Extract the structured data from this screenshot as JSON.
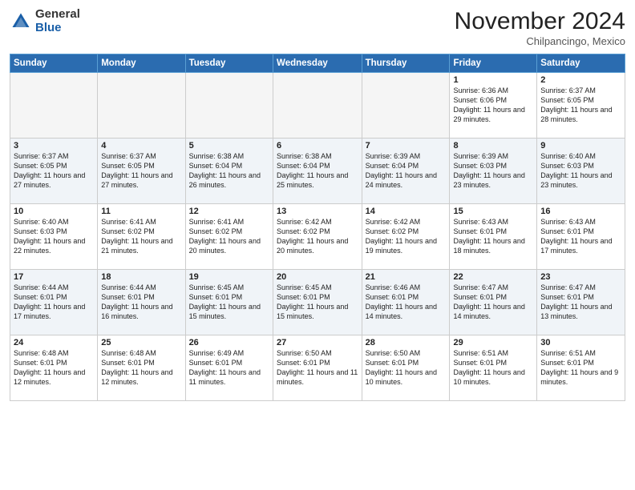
{
  "logo": {
    "general": "General",
    "blue": "Blue"
  },
  "title": "November 2024",
  "location": "Chilpancingo, Mexico",
  "days_of_week": [
    "Sunday",
    "Monday",
    "Tuesday",
    "Wednesday",
    "Thursday",
    "Friday",
    "Saturday"
  ],
  "weeks": [
    [
      {
        "day": "",
        "info": ""
      },
      {
        "day": "",
        "info": ""
      },
      {
        "day": "",
        "info": ""
      },
      {
        "day": "",
        "info": ""
      },
      {
        "day": "",
        "info": ""
      },
      {
        "day": "1",
        "info": "Sunrise: 6:36 AM\nSunset: 6:06 PM\nDaylight: 11 hours and 29 minutes."
      },
      {
        "day": "2",
        "info": "Sunrise: 6:37 AM\nSunset: 6:05 PM\nDaylight: 11 hours and 28 minutes."
      }
    ],
    [
      {
        "day": "3",
        "info": "Sunrise: 6:37 AM\nSunset: 6:05 PM\nDaylight: 11 hours and 27 minutes."
      },
      {
        "day": "4",
        "info": "Sunrise: 6:37 AM\nSunset: 6:05 PM\nDaylight: 11 hours and 27 minutes."
      },
      {
        "day": "5",
        "info": "Sunrise: 6:38 AM\nSunset: 6:04 PM\nDaylight: 11 hours and 26 minutes."
      },
      {
        "day": "6",
        "info": "Sunrise: 6:38 AM\nSunset: 6:04 PM\nDaylight: 11 hours and 25 minutes."
      },
      {
        "day": "7",
        "info": "Sunrise: 6:39 AM\nSunset: 6:04 PM\nDaylight: 11 hours and 24 minutes."
      },
      {
        "day": "8",
        "info": "Sunrise: 6:39 AM\nSunset: 6:03 PM\nDaylight: 11 hours and 23 minutes."
      },
      {
        "day": "9",
        "info": "Sunrise: 6:40 AM\nSunset: 6:03 PM\nDaylight: 11 hours and 23 minutes."
      }
    ],
    [
      {
        "day": "10",
        "info": "Sunrise: 6:40 AM\nSunset: 6:03 PM\nDaylight: 11 hours and 22 minutes."
      },
      {
        "day": "11",
        "info": "Sunrise: 6:41 AM\nSunset: 6:02 PM\nDaylight: 11 hours and 21 minutes."
      },
      {
        "day": "12",
        "info": "Sunrise: 6:41 AM\nSunset: 6:02 PM\nDaylight: 11 hours and 20 minutes."
      },
      {
        "day": "13",
        "info": "Sunrise: 6:42 AM\nSunset: 6:02 PM\nDaylight: 11 hours and 20 minutes."
      },
      {
        "day": "14",
        "info": "Sunrise: 6:42 AM\nSunset: 6:02 PM\nDaylight: 11 hours and 19 minutes."
      },
      {
        "day": "15",
        "info": "Sunrise: 6:43 AM\nSunset: 6:01 PM\nDaylight: 11 hours and 18 minutes."
      },
      {
        "day": "16",
        "info": "Sunrise: 6:43 AM\nSunset: 6:01 PM\nDaylight: 11 hours and 17 minutes."
      }
    ],
    [
      {
        "day": "17",
        "info": "Sunrise: 6:44 AM\nSunset: 6:01 PM\nDaylight: 11 hours and 17 minutes."
      },
      {
        "day": "18",
        "info": "Sunrise: 6:44 AM\nSunset: 6:01 PM\nDaylight: 11 hours and 16 minutes."
      },
      {
        "day": "19",
        "info": "Sunrise: 6:45 AM\nSunset: 6:01 PM\nDaylight: 11 hours and 15 minutes."
      },
      {
        "day": "20",
        "info": "Sunrise: 6:45 AM\nSunset: 6:01 PM\nDaylight: 11 hours and 15 minutes."
      },
      {
        "day": "21",
        "info": "Sunrise: 6:46 AM\nSunset: 6:01 PM\nDaylight: 11 hours and 14 minutes."
      },
      {
        "day": "22",
        "info": "Sunrise: 6:47 AM\nSunset: 6:01 PM\nDaylight: 11 hours and 14 minutes."
      },
      {
        "day": "23",
        "info": "Sunrise: 6:47 AM\nSunset: 6:01 PM\nDaylight: 11 hours and 13 minutes."
      }
    ],
    [
      {
        "day": "24",
        "info": "Sunrise: 6:48 AM\nSunset: 6:01 PM\nDaylight: 11 hours and 12 minutes."
      },
      {
        "day": "25",
        "info": "Sunrise: 6:48 AM\nSunset: 6:01 PM\nDaylight: 11 hours and 12 minutes."
      },
      {
        "day": "26",
        "info": "Sunrise: 6:49 AM\nSunset: 6:01 PM\nDaylight: 11 hours and 11 minutes."
      },
      {
        "day": "27",
        "info": "Sunrise: 6:50 AM\nSunset: 6:01 PM\nDaylight: 11 hours and 11 minutes."
      },
      {
        "day": "28",
        "info": "Sunrise: 6:50 AM\nSunset: 6:01 PM\nDaylight: 11 hours and 10 minutes."
      },
      {
        "day": "29",
        "info": "Sunrise: 6:51 AM\nSunset: 6:01 PM\nDaylight: 11 hours and 10 minutes."
      },
      {
        "day": "30",
        "info": "Sunrise: 6:51 AM\nSunset: 6:01 PM\nDaylight: 11 hours and 9 minutes."
      }
    ]
  ]
}
